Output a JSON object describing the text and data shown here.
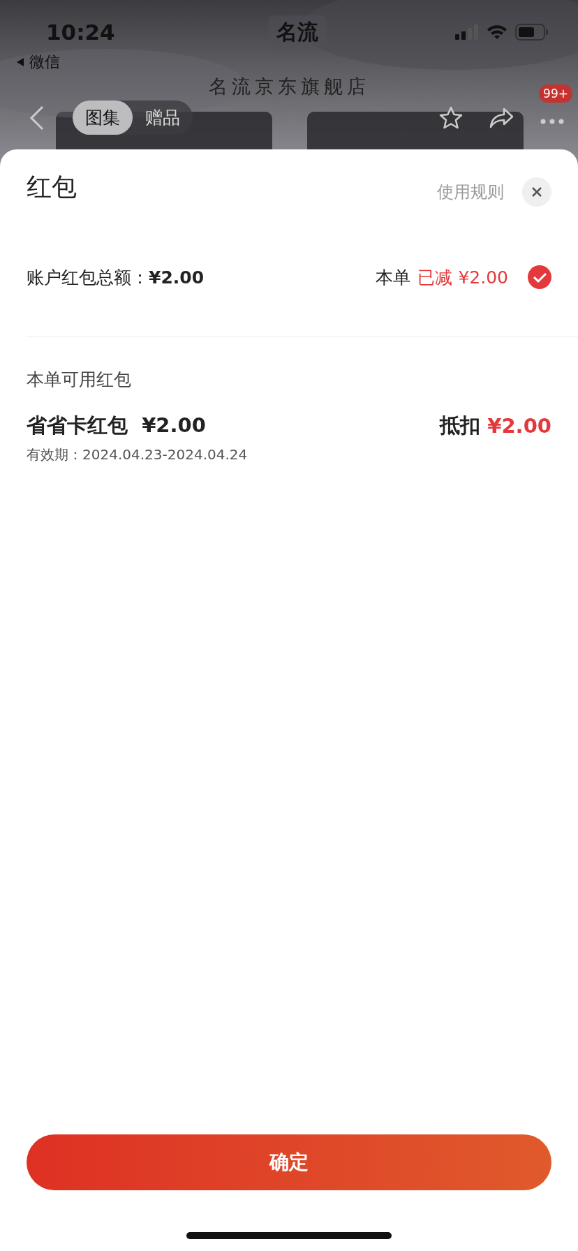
{
  "status_bar": {
    "time": "10:24",
    "back_app": "微信"
  },
  "header": {
    "logo": "名流",
    "store_name": "名流京东旗舰店",
    "tabs": [
      {
        "label": "图集",
        "selected": true
      },
      {
        "label": "赠品",
        "selected": false
      }
    ],
    "badge": "99+"
  },
  "sheet": {
    "title": "红包",
    "rules_link": "使用规则",
    "account": {
      "label": "账户红包总额：",
      "amount": "¥2.00",
      "order_label": "本单",
      "deducted": "已减 ¥2.00",
      "checked": true
    },
    "section_title": "本单可用红包",
    "packets": [
      {
        "name": "省省卡红包",
        "amount": "¥2.00",
        "validity": "有效期：2024.04.23-2024.04.24",
        "deduct_label": "抵扣",
        "deduct_amount": "¥2.00"
      }
    ],
    "confirm": "确定"
  }
}
